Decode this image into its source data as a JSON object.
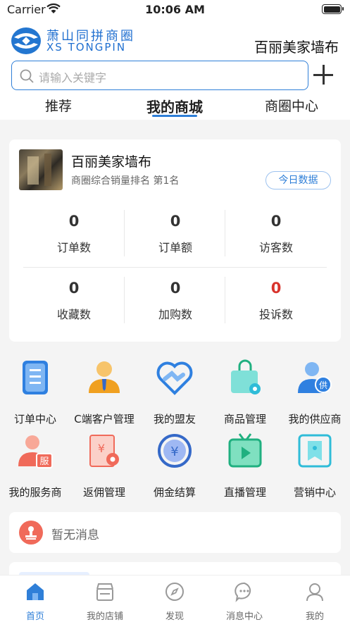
{
  "status_bar": {
    "carrier": "Carrier",
    "time": "10:06 AM"
  },
  "header": {
    "logo_cn": "萧山同拼商圈",
    "logo_en": "XS TONGPIN",
    "store_name": "百丽美家墙布",
    "search_placeholder": "请输入关键字"
  },
  "tabs": [
    {
      "label": "推荐"
    },
    {
      "label": "我的商城",
      "active": true
    },
    {
      "label": "商圈中心"
    }
  ],
  "store_card": {
    "name": "百丽美家墙布",
    "subtitle": "商圈综合销量排名 第1名",
    "today_button": "今日数据",
    "stats": [
      {
        "value": "0",
        "label": "订单数"
      },
      {
        "value": "0",
        "label": "订单额"
      },
      {
        "value": "0",
        "label": "访客数"
      },
      {
        "value": "0",
        "label": "收藏数"
      },
      {
        "value": "0",
        "label": "加购数"
      },
      {
        "value": "0",
        "label": "投诉数",
        "highlight": "#d8332c"
      }
    ]
  },
  "menu": [
    {
      "label": "订单中心",
      "icon": "order-doc-icon"
    },
    {
      "label": "C端客户管理",
      "icon": "customer-icon"
    },
    {
      "label": "我的盟友",
      "icon": "handshake-heart-icon"
    },
    {
      "label": "商品管理",
      "icon": "shopping-bag-gear-icon"
    },
    {
      "label": "我的供应商",
      "icon": "supplier-icon"
    },
    {
      "label": "我的服务商",
      "icon": "service-provider-icon"
    },
    {
      "label": "返佣管理",
      "icon": "rebate-gear-icon"
    },
    {
      "label": "佣金结算",
      "icon": "yen-refresh-icon"
    },
    {
      "label": "直播管理",
      "icon": "live-tv-icon"
    },
    {
      "label": "营销中心",
      "icon": "marketing-tag-icon"
    }
  ],
  "message": {
    "text": "暂无消息"
  },
  "tabbar": [
    {
      "label": "首页",
      "icon": "home-icon",
      "active": true
    },
    {
      "label": "我的店铺",
      "icon": "shop-icon"
    },
    {
      "label": "发现",
      "icon": "compass-icon"
    },
    {
      "label": "消息中心",
      "icon": "message-icon"
    },
    {
      "label": "我的",
      "icon": "profile-icon"
    }
  ],
  "colors": {
    "accent": "#2f7fd8",
    "icon_blue": "#2f80e0",
    "icon_orange": "#f0a020",
    "icon_cyan": "#2fbcd8",
    "icon_red": "#f06a5a",
    "icon_green": "#20b080",
    "alert_red": "#d8332c"
  }
}
